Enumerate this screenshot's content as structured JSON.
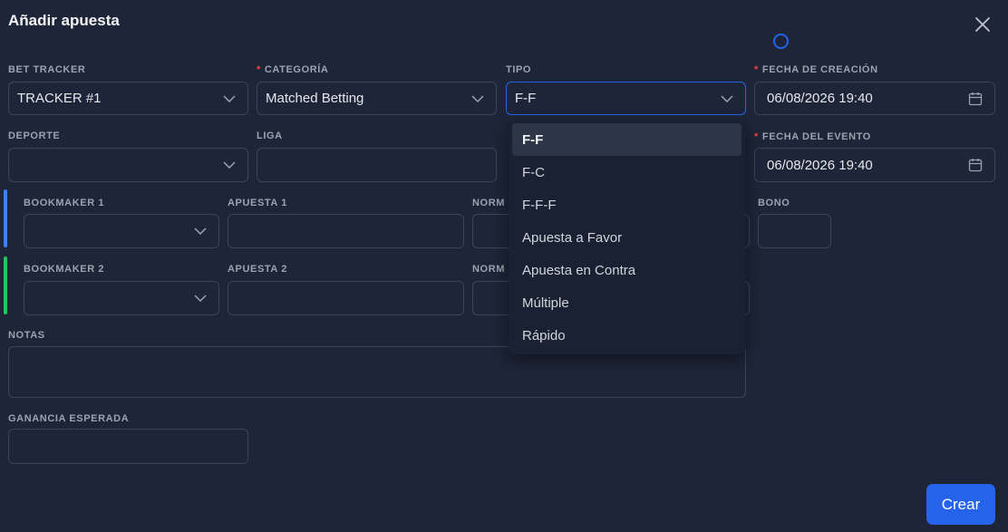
{
  "modal": {
    "title": "Añadir apuesta"
  },
  "fields": {
    "bet_tracker": {
      "label": "BET TRACKER",
      "value": "TRACKER #1"
    },
    "categoria": {
      "label": "CATEGORÍA",
      "value": "Matched Betting"
    },
    "tipo": {
      "label": "TIPO",
      "value": "F-F"
    },
    "fecha_creacion": {
      "label": "FECHA DE CREACIÓN",
      "value": "06/08/2026 19:40"
    },
    "deporte": {
      "label": "DEPORTE",
      "value": ""
    },
    "liga": {
      "label": "LIGA",
      "value": ""
    },
    "fecha_evento": {
      "label": "FECHA DEL EVENTO",
      "value": "06/08/2026 19:40"
    },
    "bookmaker1": {
      "label": "BOOKMAKER 1",
      "value": ""
    },
    "apuesta1": {
      "label": "APUESTA 1",
      "value": ""
    },
    "norm1": {
      "label": "NORM",
      "value": ""
    },
    "bono": {
      "label": "BONO",
      "value": ""
    },
    "bookmaker2": {
      "label": "BOOKMAKER 2",
      "value": ""
    },
    "apuesta2": {
      "label": "APUESTA 2",
      "value": ""
    },
    "norm2": {
      "label": "NORM",
      "value": ""
    },
    "notas": {
      "label": "NOTAS",
      "value": ""
    },
    "ganancia": {
      "label": "GANANCIA ESPERADA",
      "value": ""
    }
  },
  "required_mark": "*",
  "tipo_options": [
    "F-F",
    "F-C",
    "F-F-F",
    "Apuesta a Favor",
    "Apuesta en Contra",
    "Múltiple",
    "Rápido"
  ],
  "tipo_selected": "F-F",
  "actions": {
    "crear": "Crear"
  },
  "colors": {
    "background": "#1e2538",
    "accent": "#2563eb",
    "bookmaker1_bar": "#3b82f6",
    "bookmaker2_bar": "#22c55e",
    "required": "#ef4444"
  },
  "icons": [
    "close-icon",
    "loading-spinner-icon",
    "chevron-down-icon",
    "calendar-icon"
  ]
}
